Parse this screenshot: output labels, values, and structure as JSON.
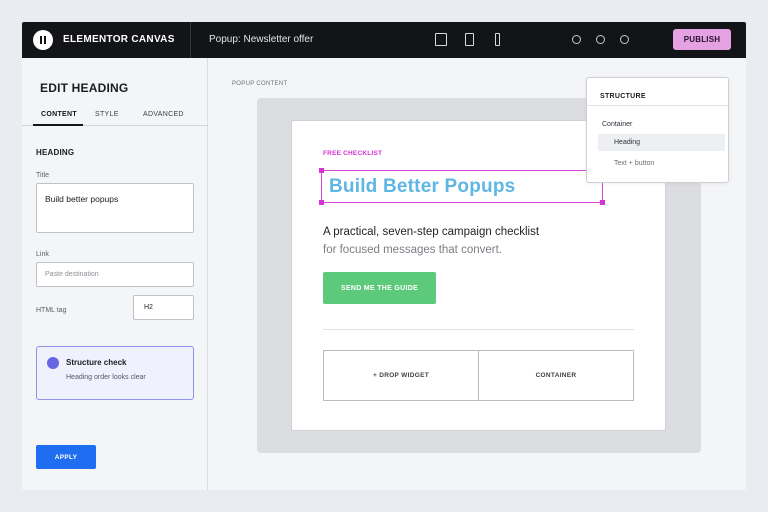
{
  "topbar": {
    "brand": "ELEMENTOR CANVAS",
    "document_title": "Popup: Newsletter offer",
    "publish_label": "PUBLISH",
    "device_icons": [
      "desktop-icon",
      "tablet-icon",
      "mobile-icon"
    ],
    "status_icons": [
      "circle-icon",
      "circle-icon",
      "circle-icon"
    ]
  },
  "panel": {
    "title": "EDIT HEADING",
    "tabs": [
      {
        "label": "CONTENT",
        "active": true
      },
      {
        "label": "STYLE",
        "active": false
      },
      {
        "label": "ADVANCED",
        "active": false
      }
    ],
    "section": "HEADING",
    "title_field": {
      "label": "Title",
      "value": "Build better popups"
    },
    "link_field": {
      "label": "Link",
      "placeholder": "Paste destination",
      "value": ""
    },
    "html_tag": {
      "label": "HTML tag",
      "value": "H2"
    },
    "check": {
      "title": "Structure check",
      "message": "Heading order looks clear"
    },
    "apply_label": "APPLY"
  },
  "canvas": {
    "label": "POPUP CONTENT",
    "popup": {
      "kicker": "FREE CHECKLIST",
      "heading": "Build Better Popups",
      "body_line1": "A practical, seven-step campaign checklist",
      "body_line2": "for focused messages that convert.",
      "cta": "SEND ME THE GUIDE",
      "slots": [
        "+ DROP WIDGET",
        "CONTAINER"
      ]
    }
  },
  "structure": {
    "title": "STRUCTURE",
    "items": [
      {
        "label": "Container",
        "level": 0,
        "selected": false
      },
      {
        "label": "Heading",
        "level": 1,
        "selected": true
      },
      {
        "label": "Text + button",
        "level": 1,
        "selected": false
      }
    ]
  },
  "colors": {
    "topbar": "#131418",
    "publish": "#e4a2e3",
    "accent_magenta": "#d633d2",
    "heading_blue": "#5fb6e3",
    "cta_green": "#5dc97b",
    "apply_blue": "#1f6df0",
    "check_purple": "#6766e4"
  }
}
